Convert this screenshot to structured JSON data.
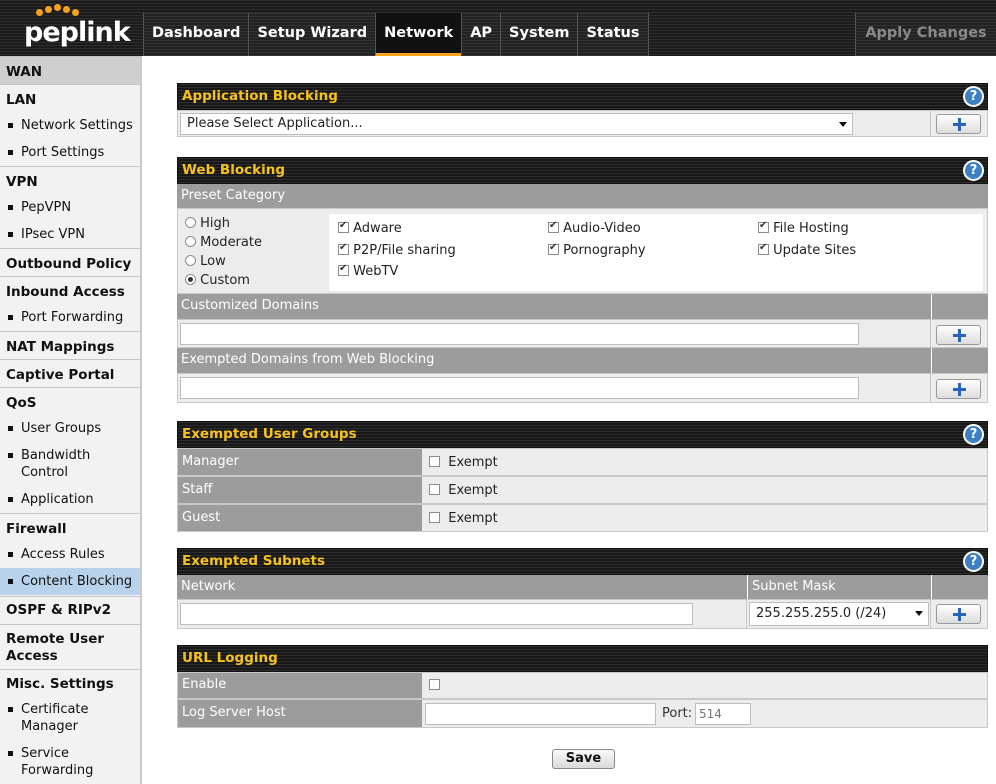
{
  "brand": {
    "logo_text": "peplink"
  },
  "nav": {
    "tabs": [
      "Dashboard",
      "Setup Wizard",
      "Network",
      "AP",
      "System",
      "Status"
    ],
    "active": "Network",
    "apply_label": "Apply Changes"
  },
  "sidebar": {
    "wan": "WAN",
    "lan": "LAN",
    "network_settings": "Network Settings",
    "port_settings": "Port Settings",
    "vpn": "VPN",
    "pepvpn": "PepVPN",
    "ipsec_vpn": "IPsec VPN",
    "outbound_policy": "Outbound Policy",
    "inbound_access": "Inbound Access",
    "port_forwarding": "Port Forwarding",
    "nat_mappings": "NAT Mappings",
    "captive_portal": "Captive Portal",
    "qos": "QoS",
    "user_groups": "User Groups",
    "bandwidth_control_1": "Bandwidth",
    "bandwidth_control_2": "Control",
    "application": "Application",
    "firewall": "Firewall",
    "access_rules": "Access Rules",
    "content_blocking": "Content Blocking",
    "ospf_rip": "OSPF & RIPv2",
    "remote_user_access_1": "Remote User",
    "remote_user_access_2": "Access",
    "misc_settings": "Misc. Settings",
    "certificate_manager_1": "Certificate",
    "certificate_manager_2": "Manager",
    "service_forwarding_1": "Service",
    "service_forwarding_2": "Forwarding"
  },
  "app_blocking": {
    "title": "Application Blocking",
    "select_value": "Please Select Application..."
  },
  "web_blocking": {
    "title": "Web Blocking",
    "preset_label": "Preset Category",
    "levels": [
      "High",
      "Moderate",
      "Low",
      "Custom"
    ],
    "selected_level": "Custom",
    "categories": [
      "Adware",
      "Audio-Video",
      "File Hosting",
      "P2P/File sharing",
      "Pornography",
      "Update Sites",
      "WebTV"
    ],
    "customized_domains_label": "Customized Domains",
    "exempted_domains_label": "Exempted Domains from Web Blocking"
  },
  "exempted_user_groups": {
    "title": "Exempted User Groups",
    "groups": [
      "Manager",
      "Staff",
      "Guest"
    ],
    "exempt_label": "Exempt"
  },
  "exempted_subnets": {
    "title": "Exempted Subnets",
    "network_label": "Network",
    "mask_label": "Subnet Mask",
    "mask_value": "255.255.255.0 (/24)"
  },
  "url_logging": {
    "title": "URL Logging",
    "enable_label": "Enable",
    "host_label": "Log Server Host",
    "port_label": "Port:",
    "port_placeholder": "514"
  },
  "help_glyph": "?",
  "save_label": "Save",
  "colors": {
    "accent": "#f7a21b",
    "header_text": "#f7c21b",
    "help_blue": "#3b7fc4",
    "active_item": "#b9d2ec"
  }
}
